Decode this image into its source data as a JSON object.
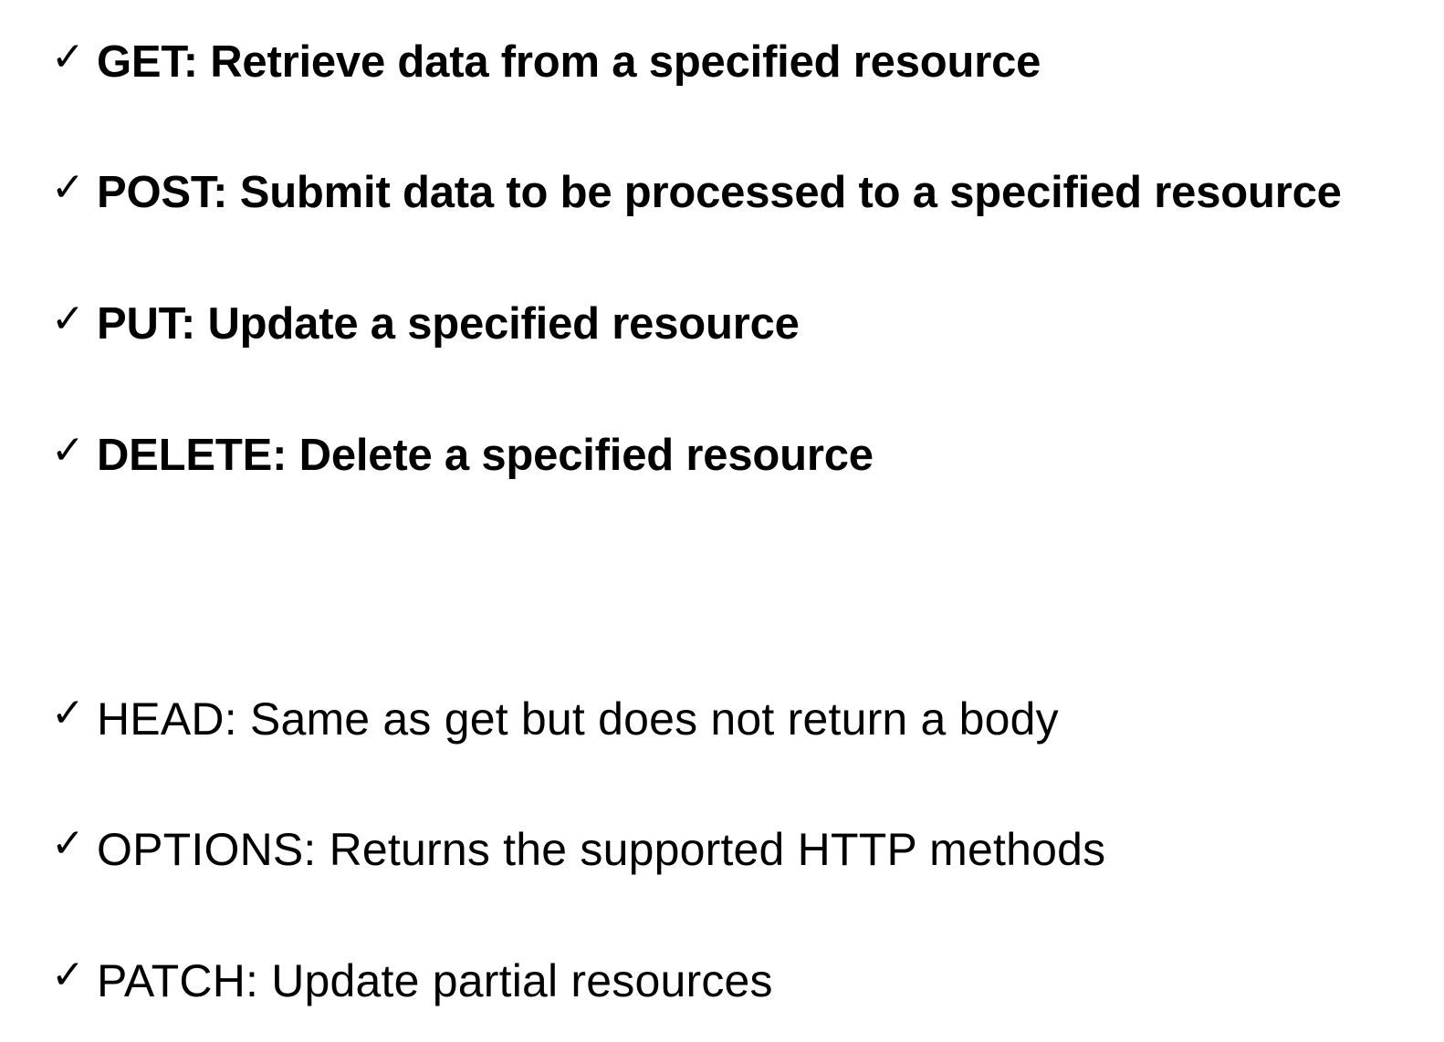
{
  "check_symbol": "✓",
  "primary_methods": [
    {
      "text": "GET: Retrieve data from a specified resource"
    },
    {
      "text": "POST: Submit data to be processed to a specified resource"
    },
    {
      "text": "PUT: Update a specified resource"
    },
    {
      "text": "DELETE: Delete a specified resource"
    }
  ],
  "other_methods": [
    {
      "text": "HEAD: Same as get but does not return a body"
    },
    {
      "text": "OPTIONS: Returns the supported HTTP methods"
    },
    {
      "text": "PATCH: Update partial resources"
    }
  ]
}
